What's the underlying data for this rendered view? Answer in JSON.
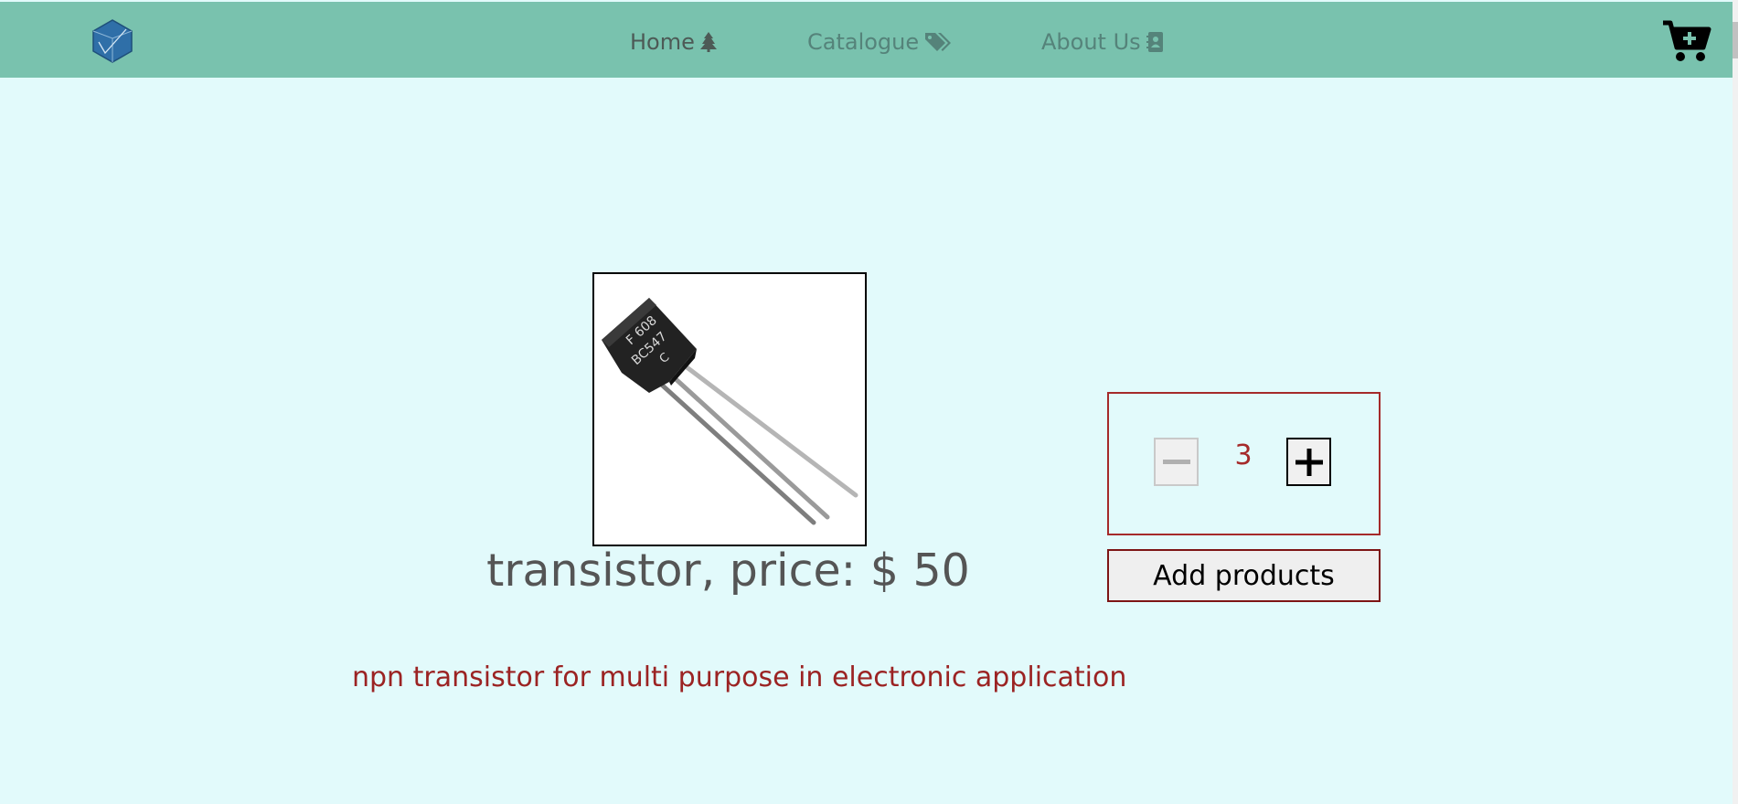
{
  "navbar": {
    "logo_icon": "icosahedron-logo-icon",
    "links": [
      {
        "label": "Home",
        "icon": "tree-icon"
      },
      {
        "label": "Catalogue",
        "icon": "tags-icon"
      },
      {
        "label": "About Us",
        "icon": "address-book-icon"
      }
    ],
    "cart_icon": "cart-plus-icon"
  },
  "product": {
    "image_icon": "transistor-image",
    "title": "transistor, price: $ 50",
    "description": "npn transistor for multi purpose in electronic application"
  },
  "quantity": {
    "value": "3",
    "decrement_icon": "minus-icon",
    "increment_icon": "plus-icon"
  },
  "add_button": {
    "label": "Add products"
  },
  "colors": {
    "page_background": "#e2fafb",
    "navbar": "#79c2ae",
    "accent": "#a52a2a",
    "description_text": "#9b2323",
    "title_text": "#555555"
  }
}
